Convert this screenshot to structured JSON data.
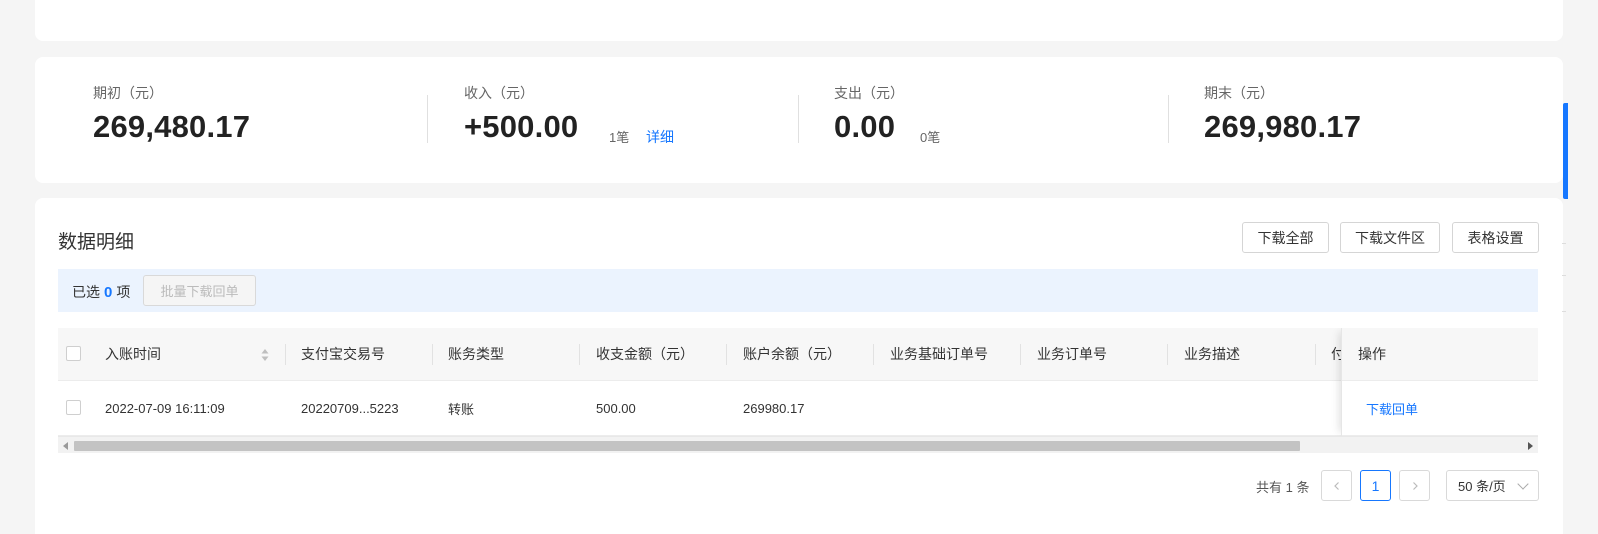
{
  "summary": {
    "opening": {
      "label": "期初（元）",
      "value": "269,480.17"
    },
    "income": {
      "label": "收入（元）",
      "value": "+500.00",
      "count": "1笔",
      "detail_link": "详细"
    },
    "expense": {
      "label": "支出（元）",
      "value": "0.00",
      "count": "0笔"
    },
    "closing": {
      "label": "期末（元）",
      "value": "269,980.17"
    }
  },
  "details": {
    "title": "数据明细",
    "buttons": {
      "download_all": "下载全部",
      "download_files": "下载文件区",
      "table_settings": "表格设置"
    },
    "selection": {
      "prefix": "已选",
      "count": "0",
      "suffix": "项",
      "batch_download": "批量下载回单"
    }
  },
  "table": {
    "columns": [
      "入账时间",
      "支付宝交易号",
      "账务类型",
      "收支金额（元）",
      "账户余额（元）",
      "业务基础订单号",
      "业务订单号",
      "业务描述",
      "付"
    ],
    "action_column": "操作",
    "rows": [
      {
        "time": "2022-07-09 16:11:09",
        "trade_no": "20220709...5223",
        "type": "转账",
        "amount": "500.00",
        "balance": "269980.17",
        "base_order": "",
        "order": "",
        "desc": "",
        "action": "下载回单"
      }
    ]
  },
  "pagination": {
    "total": "共有 1 条",
    "current_page": "1",
    "page_size": "50 条/页"
  },
  "colors": {
    "accent": "#1677ff",
    "selection_bg": "#ebf3fe"
  }
}
